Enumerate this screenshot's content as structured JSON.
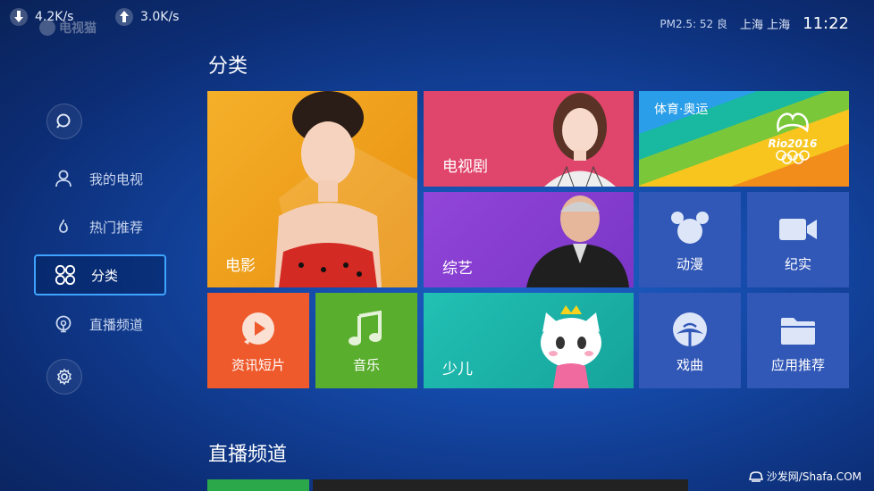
{
  "status_bar": {
    "download_speed": "4.2K/s",
    "upload_speed": "3.0K/s",
    "app_logo_text": "电视猫",
    "air_quality": "PM2.5: 52 良",
    "location": "上海 上海",
    "time": "11:22"
  },
  "sidebar": {
    "search_icon": "search-icon",
    "items": [
      {
        "label": "我的电视",
        "icon": "user-icon"
      },
      {
        "label": "热门推荐",
        "icon": "flame-icon"
      },
      {
        "label": "分类",
        "icon": "four-circles-icon",
        "active": true
      },
      {
        "label": "直播频道",
        "icon": "broadcast-icon"
      }
    ],
    "settings_icon": "gear-icon"
  },
  "main": {
    "section_title": "分类",
    "tiles": {
      "movie": "电影",
      "tv_series": "电视剧",
      "sports": "体育·奥运",
      "sports_badge": "Rio2016",
      "variety": "综艺",
      "anime": "动漫",
      "documentary": "纪实",
      "news_clips": "资讯短片",
      "music": "音乐",
      "kids": "少儿",
      "opera": "戏曲",
      "app_recommend": "应用推荐"
    },
    "live_section_title": "直播频道"
  },
  "watermark": "沙发网/Shafa.COM",
  "colors": {
    "movie": "#f0a218",
    "tv_series": "#e0456c",
    "variety": "#8a3fd2",
    "news_clips": "#ef5a2c",
    "music": "#5aae2e",
    "kids": "#1bb0a8",
    "blue_tile": "#3157b7",
    "active_border": "#3ea4ff"
  }
}
